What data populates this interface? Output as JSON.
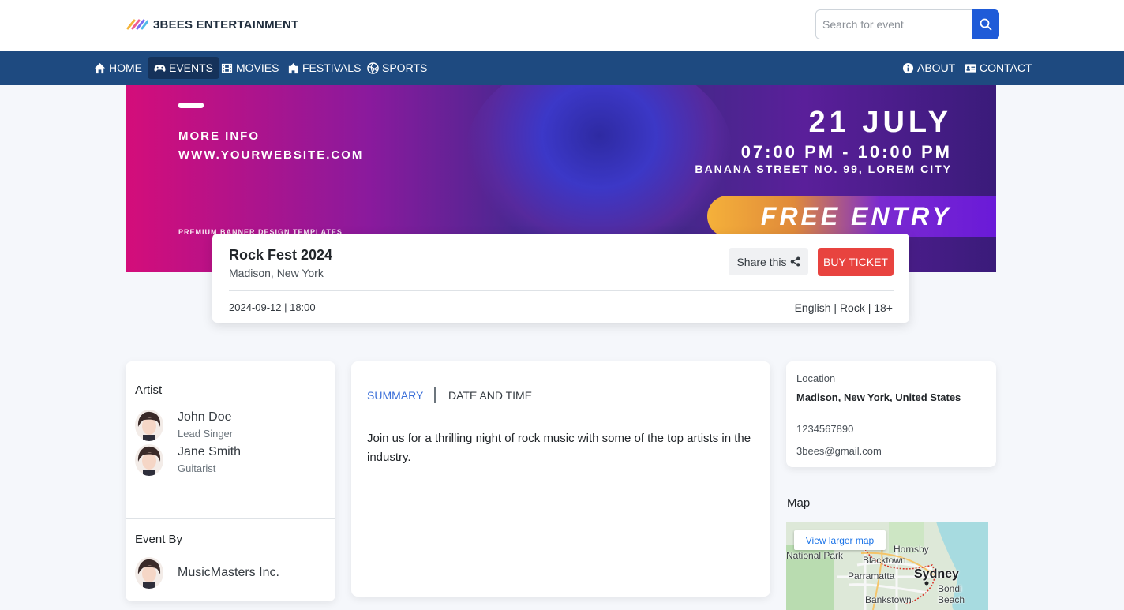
{
  "brand": {
    "name": "3BEES ENTERTAINMENT"
  },
  "search": {
    "placeholder": "Search for event"
  },
  "nav": {
    "left": [
      {
        "label": "HOME",
        "icon": "home-icon",
        "active": false
      },
      {
        "label": "EVENTS",
        "icon": "gamepad-icon",
        "active": true
      },
      {
        "label": "MOVIES",
        "icon": "film-icon",
        "active": false
      },
      {
        "label": "FESTIVALS",
        "icon": "festival-icon",
        "active": false
      },
      {
        "label": "SPORTS",
        "icon": "volleyball-icon",
        "active": false
      }
    ],
    "right": [
      {
        "label": "ABOUT",
        "icon": "info-icon"
      },
      {
        "label": "CONTACT",
        "icon": "contact-card-icon"
      }
    ]
  },
  "banner": {
    "more_info": "MORE INFO",
    "website": "WWW.YOURWEBSITE.COM",
    "premium": "PREMIUM BANNER DESIGN TEMPLATES",
    "date": "21 JULY",
    "time": "07:00 PM - 10:00 PM",
    "address": "BANANA STREET NO. 99, LOREM CITY",
    "entry": "FREE ENTRY"
  },
  "event": {
    "title": "Rock Fest 2024",
    "location": "Madison, New York",
    "share_label": "Share this",
    "buy_label": "BUY TICKET",
    "datetime": "2024-09-12 | 18:00",
    "meta": "English | Rock | 18+"
  },
  "artists": {
    "heading": "Artist",
    "items": [
      {
        "name": "John Doe",
        "role": "Lead Singer"
      },
      {
        "name": "Jane Smith",
        "role": "Guitarist"
      }
    ]
  },
  "event_by": {
    "heading": "Event By",
    "name": "MusicMasters Inc."
  },
  "tabs": {
    "summary": "SUMMARY",
    "date_time": "DATE AND TIME"
  },
  "summary": {
    "text": "Join us for a thrilling night of rock music with some of the top artists in the industry."
  },
  "contact": {
    "location_label": "Location",
    "location_value": "Madison, New York, United States",
    "phone": "1234567890",
    "email": "3bees@gmail.com"
  },
  "map": {
    "title": "Map",
    "view_larger": "View larger map",
    "labels": {
      "national_park": "National Park",
      "hornsby": "Hornsby",
      "blacktown": "Blacktown",
      "parramatta": "Parramatta",
      "sydney": "Sydney",
      "bondi": "Bondi Beach",
      "bankstown": "Bankstown"
    }
  },
  "colors": {
    "nav_bg": "#1e4a80",
    "accent_blue": "#1f5bd8",
    "buy_red": "#e8433f",
    "tab_active": "#3b6fd8"
  }
}
